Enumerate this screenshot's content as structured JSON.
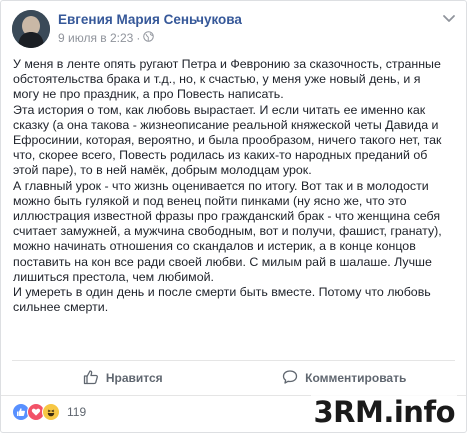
{
  "post": {
    "author": "Евгения Мария Сеньчукова",
    "timestamp": "9 июля в 2:23",
    "meta_separator": "·",
    "paragraphs": [
      "У меня в ленте опять ругают Петра и Февронию за сказочность, странные\nобстоятельства брака и т.д., но, к счастью, у меня уже новый день, и я\nмогу не про праздник, а про Повесть написать.",
      "Эта история о том, как любовь вырастает. И если читать ее именно как\nсказку (а она такова - жизнеописание реальной княжеской четы Давида и\nЕфросинии, которая, вероятно, и была прообразом, ничего такого нет, так\nчто, скорее всего, Повесть родилась из каких-то народных преданий об\nэтой паре), то в ней намёк, добрым молодцам урок.",
      "А главный урок - что жизнь оценивается по итогу. Вот так и в молодости\nможно быть гулякой и под венец пойти пинками (ну ясно же, что это\nиллюстрация известной фразы про гражданский брак - что женщина себя\nсчитает замужней, а мужчина свободным, вот и получи, фашист, гранату),\nможно начинать отношения со скандалов и истерик, а в конце концов\nпоставить на кон все ради своей любви. С милым рай в шалаше. Лучше\nлишиться престола, чем любимой.",
      "И умереть в один день и после смерти быть вместе. Потому что любовь\nсильнее смерти."
    ]
  },
  "actions": {
    "like_label": "Нравится",
    "comment_label": "Комментировать"
  },
  "reactions": {
    "count": "119",
    "types": [
      "like-icon",
      "love-icon",
      "haha-icon"
    ],
    "colors": {
      "like": "#5890ff",
      "love": "#f25268",
      "haha": "#f7c744"
    }
  },
  "icons": [
    "globe-icon",
    "chevron-down-icon",
    "thumbs-up-icon",
    "comment-icon"
  ],
  "colors": {
    "author_link": "#365899",
    "meta_gray": "#90949c",
    "text": "#1d2129",
    "action_gray": "#606770"
  },
  "watermark": "3RM.info"
}
